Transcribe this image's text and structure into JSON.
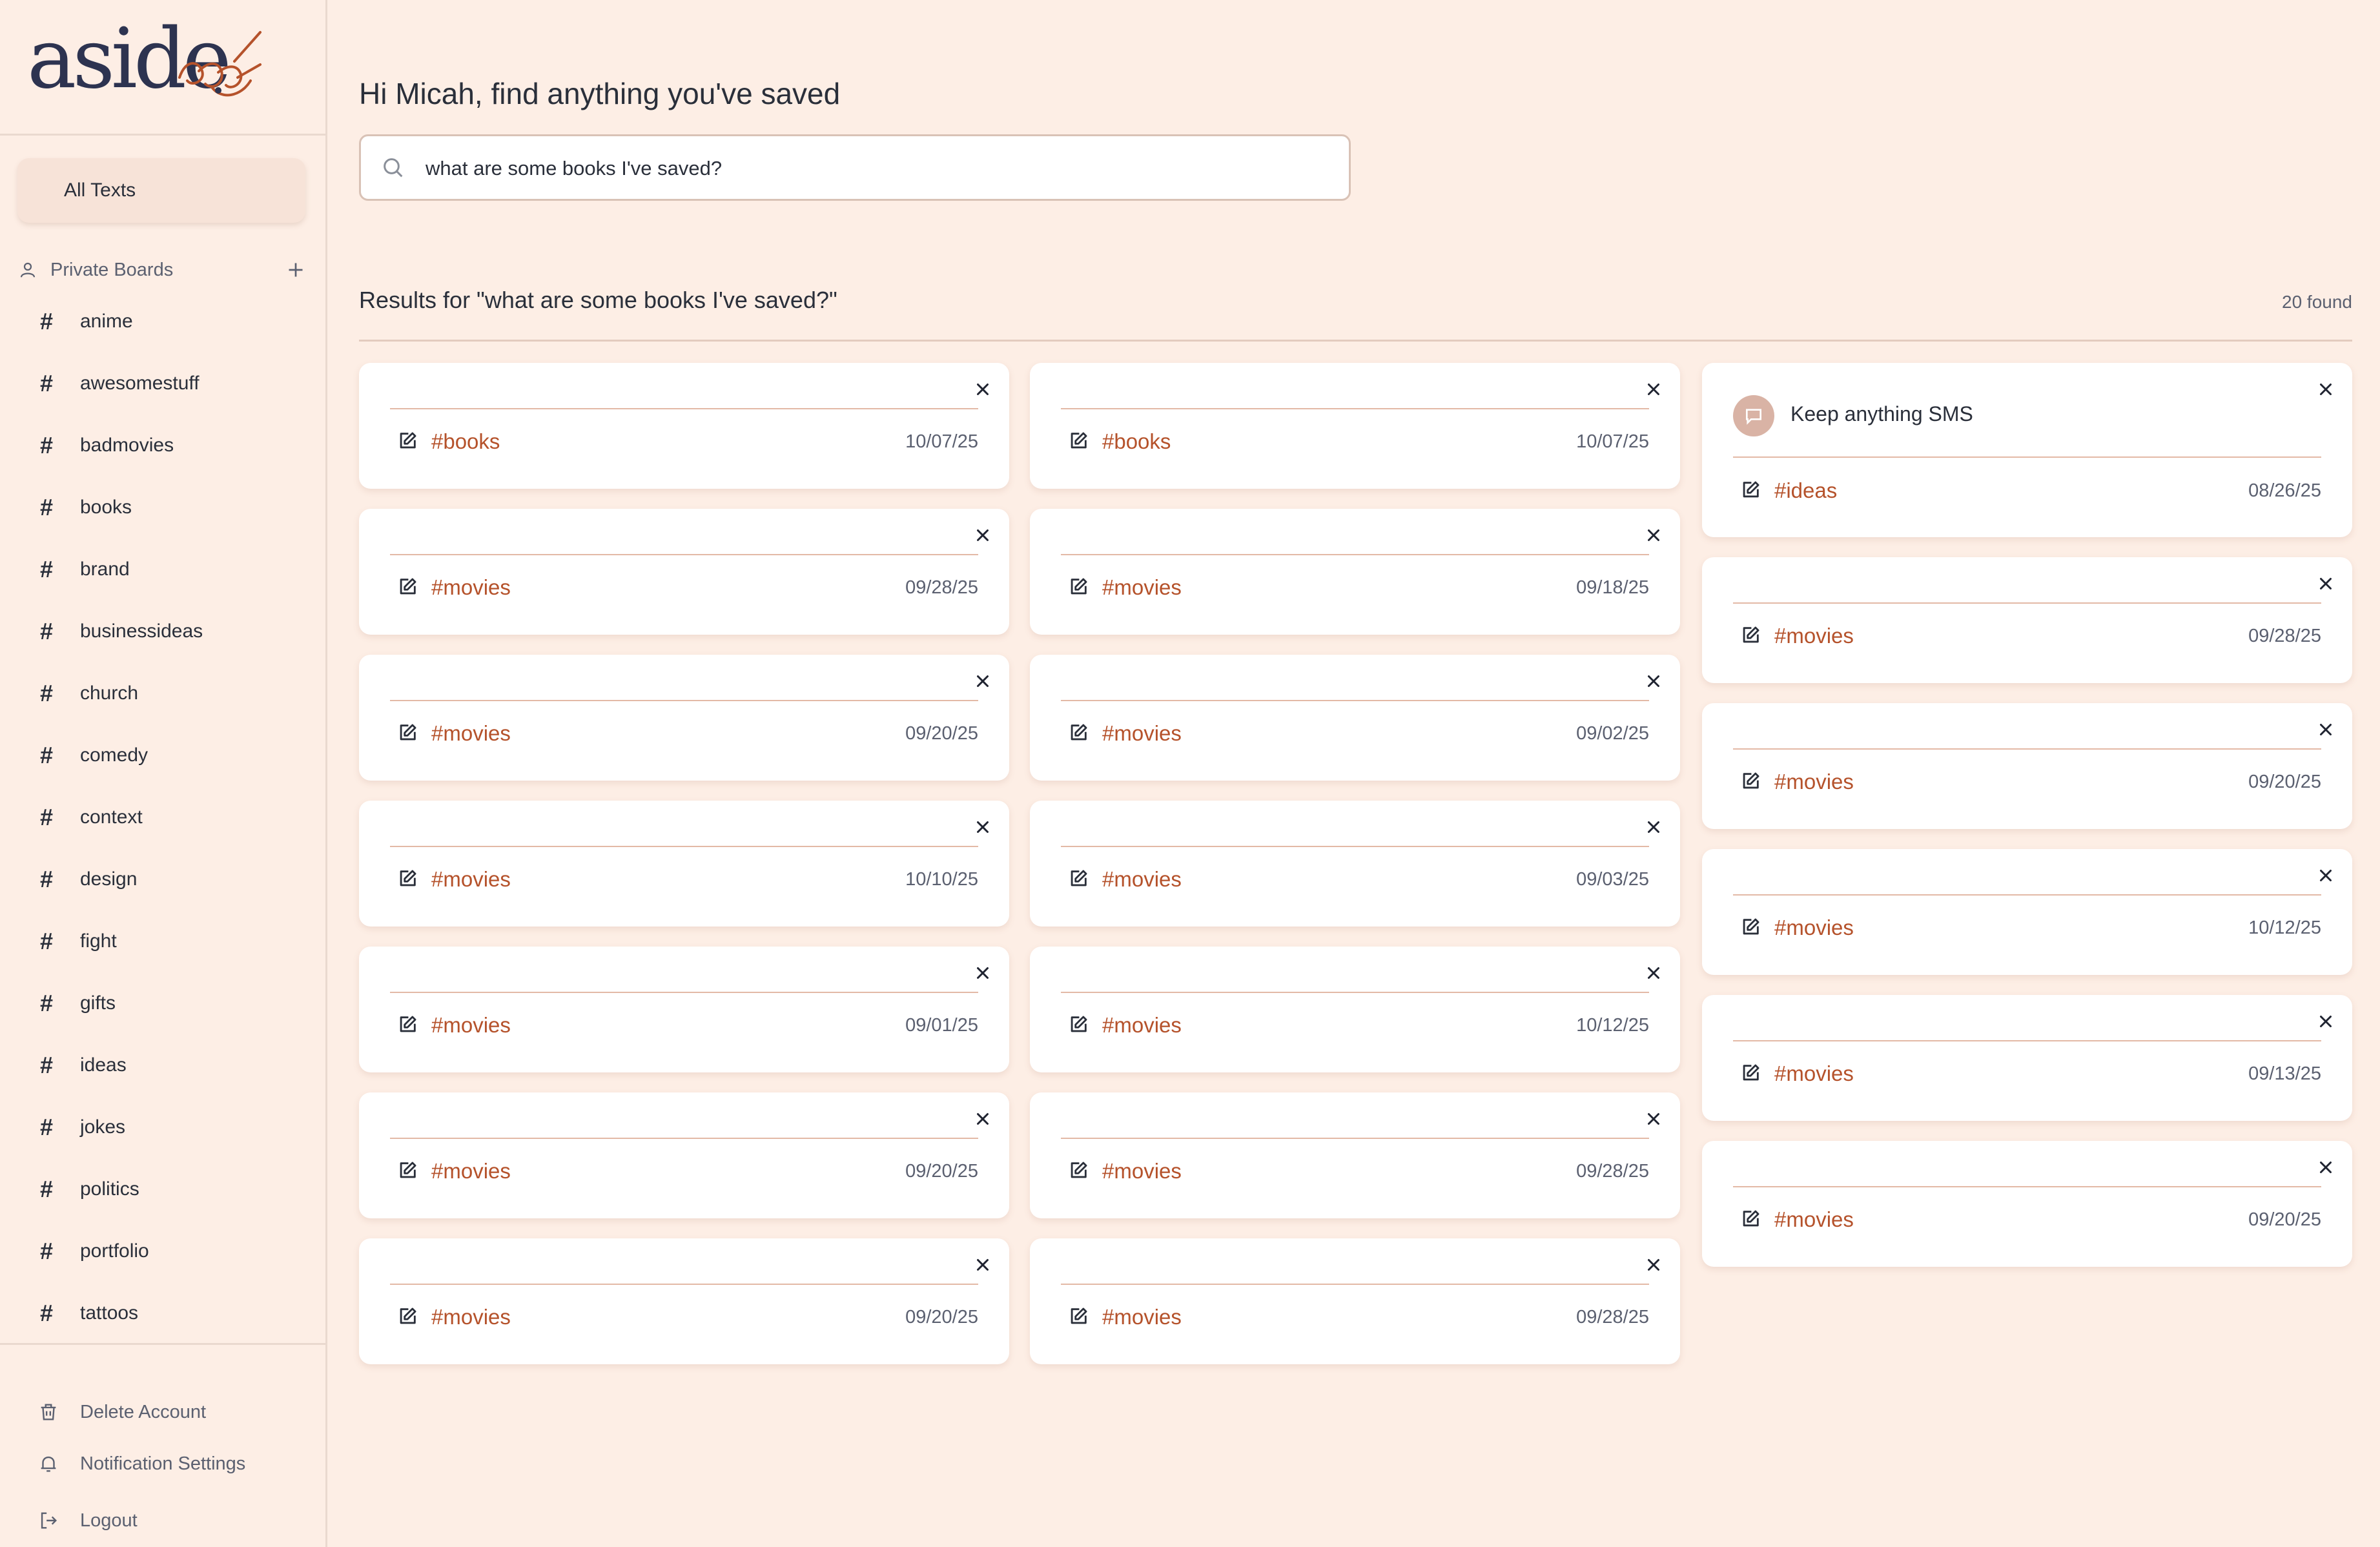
{
  "sidebar": {
    "logo_text": "aside",
    "all_texts": "All Texts",
    "private_boards": "Private Boards",
    "boards": [
      "anime",
      "awesomestuff",
      "badmovies",
      "books",
      "brand",
      "businessideas",
      "church",
      "comedy",
      "context",
      "design",
      "fight",
      "gifts",
      "ideas",
      "jokes",
      "politics",
      "portfolio",
      "tattoos"
    ],
    "hash_symbol": "#",
    "bottom": {
      "delete_account": "Delete Account",
      "notification_settings": "Notification Settings",
      "logout": "Logout"
    }
  },
  "main": {
    "greeting": "Hi Micah, find anything you've saved",
    "search_value": "what are some books I've saved?",
    "results_title": "Results for \"what are some books I've saved?\"",
    "results_count": "20 found",
    "columns": [
      [
        {
          "tag": "#books",
          "date": "10/07/25"
        },
        {
          "tag": "#movies",
          "date": "09/28/25"
        },
        {
          "tag": "#movies",
          "date": "09/20/25"
        },
        {
          "tag": "#movies",
          "date": "10/10/25"
        },
        {
          "tag": "#movies",
          "date": "09/01/25"
        },
        {
          "tag": "#movies",
          "date": "09/20/25"
        },
        {
          "tag": "#movies",
          "date": "09/20/25"
        }
      ],
      [
        {
          "tag": "#books",
          "date": "10/07/25"
        },
        {
          "tag": "#movies",
          "date": "09/18/25"
        },
        {
          "tag": "#movies",
          "date": "09/02/25"
        },
        {
          "tag": "#movies",
          "date": "09/03/25"
        },
        {
          "tag": "#movies",
          "date": "10/12/25"
        },
        {
          "tag": "#movies",
          "date": "09/28/25"
        },
        {
          "tag": "#movies",
          "date": "09/28/25"
        }
      ],
      [
        {
          "tag": "#ideas",
          "date": "08/26/25",
          "message": "Keep anything SMS"
        },
        {
          "tag": "#movies",
          "date": "09/28/25"
        },
        {
          "tag": "#movies",
          "date": "09/20/25"
        },
        {
          "tag": "#movies",
          "date": "10/12/25"
        },
        {
          "tag": "#movies",
          "date": "09/13/25"
        },
        {
          "tag": "#movies",
          "date": "09/20/25"
        }
      ]
    ]
  },
  "colors": {
    "background": "#fdeee5",
    "accent_tag": "#b5522b",
    "card": "#ffffff"
  }
}
